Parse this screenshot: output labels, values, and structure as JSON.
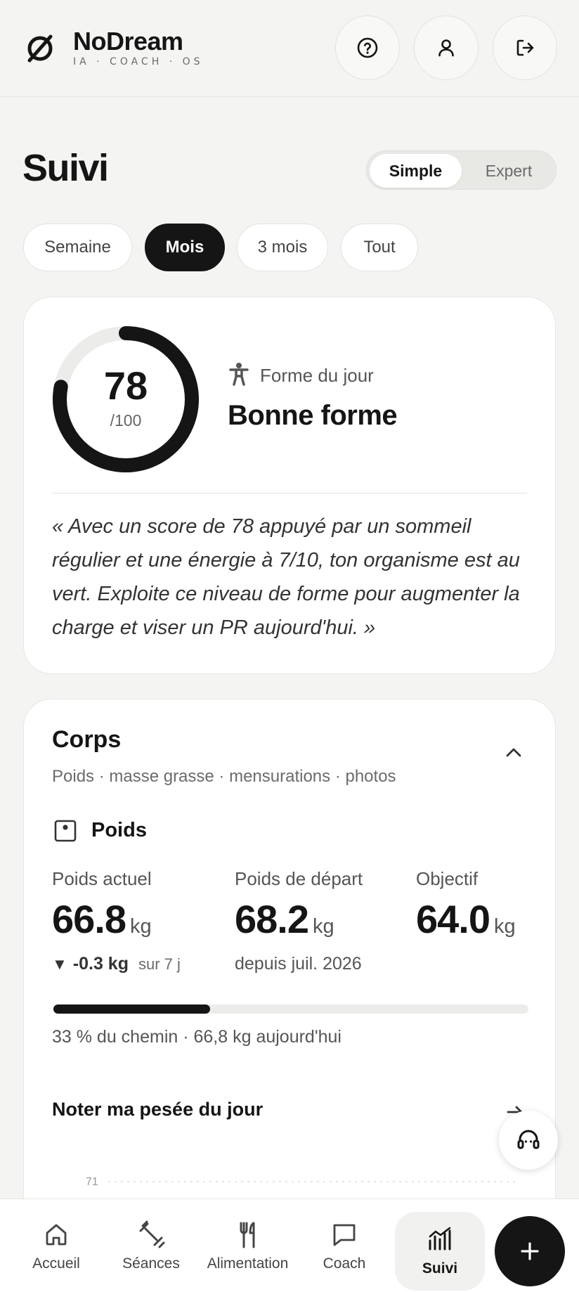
{
  "header": {
    "brand_name": "NoDream",
    "brand_tagline": "IA · COACH · OS",
    "logo_icon": "null-set-icon",
    "actions": [
      {
        "icon": "help-circle-icon"
      },
      {
        "icon": "user-icon"
      },
      {
        "icon": "logout-icon"
      }
    ]
  },
  "page": {
    "title": "Suivi",
    "mode_toggle": {
      "options": [
        "Simple",
        "Expert"
      ],
      "selected": "Simple"
    },
    "ranges": [
      "Semaine",
      "Mois",
      "3 mois",
      "Tout"
    ],
    "selected_range": "Mois"
  },
  "form_card": {
    "score": "78",
    "score_max": "/100",
    "score_fraction": 0.78,
    "label": "Forme du jour",
    "status": "Bonne forme",
    "quote": "« Avec un score de 78 appuyé par un sommeil régulier et une énergie à 7/10, ton organisme est au vert. Exploite ce niveau de forme pour augmenter la charge et viser un PR aujourd'hui. »"
  },
  "body_card": {
    "title": "Corps",
    "subtitle": "Poids · masse grasse · mensurations · photos",
    "weight": {
      "title": "Poids",
      "current_label": "Poids actuel",
      "current_value": "66.8",
      "start_label": "Poids de départ",
      "start_value": "68.2",
      "goal_label": "Objectif",
      "goal_value": "64.0",
      "unit": "kg",
      "delta_value": "-0.3 kg",
      "delta_period": "sur 7 j",
      "since_text": "depuis juil. 2026",
      "progress_fraction": 0.33,
      "progress_text": "33 % du chemin · 66,8 kg aujourd'hui"
    },
    "log_action": "Noter ma pesée du jour",
    "chart_top_tick": "71"
  },
  "bottom_nav": {
    "items": [
      {
        "label": "Accueil",
        "icon": "home-icon"
      },
      {
        "label": "Séances",
        "icon": "dumbbell-icon"
      },
      {
        "label": "Alimentation",
        "icon": "utensils-icon"
      },
      {
        "label": "Coach",
        "icon": "chat-icon"
      },
      {
        "label": "Suivi",
        "icon": "chart-icon"
      }
    ],
    "active": "Suivi"
  },
  "colors": {
    "background": "#f4f4f2",
    "ink": "#151515",
    "card": "#ffffff",
    "muted": "#6b6b6b"
  }
}
